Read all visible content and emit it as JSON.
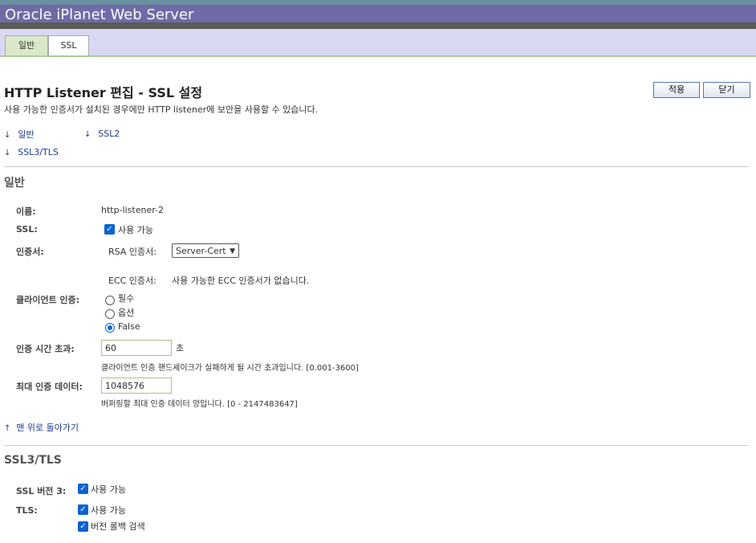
{
  "app": {
    "title": "Oracle iPlanet Web Server"
  },
  "tabs": [
    {
      "label": "일반"
    },
    {
      "label": "SSL"
    }
  ],
  "page": {
    "title": "HTTP Listener 편집 - SSL 설정",
    "subtitle": "사용 가능한 인증서가 설치된 경우에만 HTTP listener에 보안을 사용할 수 있습니다.",
    "apply_label": "적용",
    "close_label": "닫기"
  },
  "jumplinks": [
    {
      "label": "일반"
    },
    {
      "label": "SSL2"
    },
    {
      "label": "SSL3/TLS"
    }
  ],
  "general": {
    "title": "일반",
    "name_label": "이름:",
    "name_value": "http-listener-2",
    "ssl_label": "SSL:",
    "ssl_enabled_label": "사용 가능",
    "ssl_enabled": true,
    "cert_label": "인증서:",
    "rsa_label": "RSA 인증서:",
    "rsa_value": "Server-Cert",
    "ecc_label": "ECC 인증서:",
    "ecc_value": "사용 가능한 ECC 인증서가 없습니다.",
    "client_auth_label": "클라이언트 인증:",
    "client_auth_options": [
      "필수",
      "옵션",
      "False"
    ],
    "client_auth_selected": "False",
    "auth_timeout_label": "인증 시간 초과:",
    "auth_timeout_value": "60",
    "auth_timeout_unit": "초",
    "auth_timeout_help": "클라이언트 인증 핸드셰이크가 실패하게 될 시간 초과입니다. [0.001-3600]",
    "max_auth_label": "최대 인증 데이터:",
    "max_auth_value": "1048576",
    "max_auth_help": "버퍼링할 최대 인증 데이터 양입니다. [0 - 2147483647]",
    "back_to_top": "맨 위로 돌아가기"
  },
  "ssl3tls": {
    "title": "SSL3/TLS",
    "ssl3_label": "SSL 버전 3:",
    "ssl3_enabled_label": "사용 가능",
    "tls_label": "TLS:",
    "tls_enabled_label": "사용 가능",
    "rollback_label": "버전 롤백 검색"
  },
  "colors": {
    "titlebar": "#6e6ba6",
    "tabband": "#d9d8f2",
    "accent": "#0b62d0",
    "link": "#1e3a8a"
  }
}
